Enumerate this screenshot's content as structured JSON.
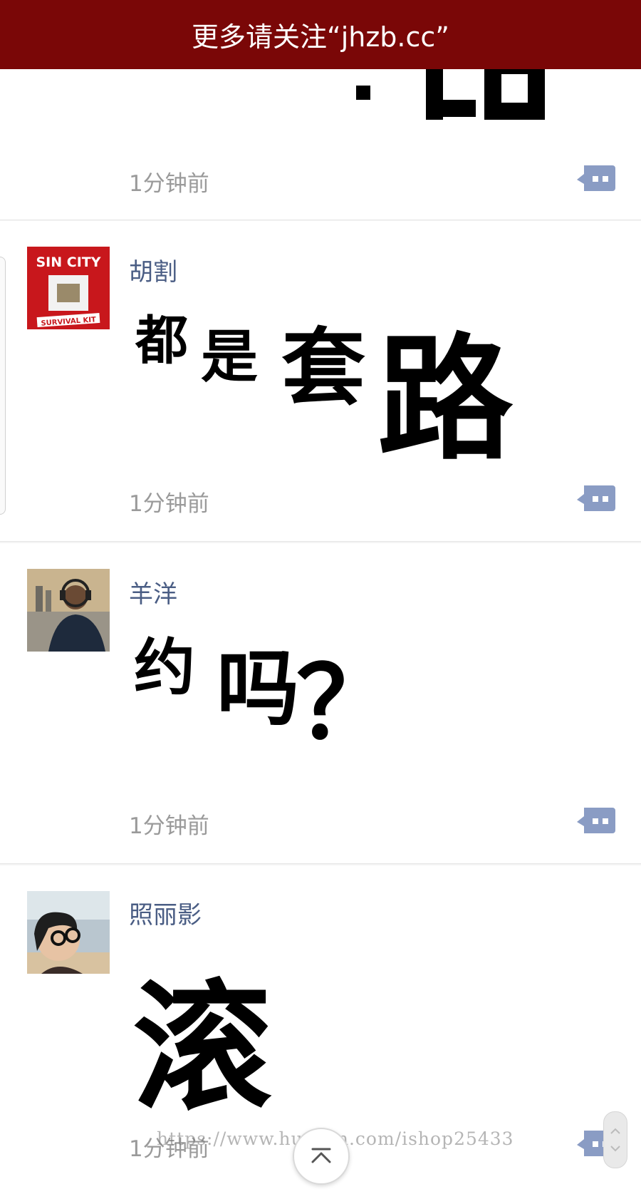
{
  "banner": {
    "text": "更多请关注“jhzb.cc”"
  },
  "cards": [
    {
      "time": "1分钟前"
    },
    {
      "username": "胡割",
      "sticker": [
        "都",
        "是",
        "套",
        "路"
      ],
      "time": "1分钟前",
      "avatar_text": [
        "SIN CITY",
        "SURVIVAL KIT"
      ]
    },
    {
      "username": "羊洋",
      "sticker": [
        "约",
        "吗",
        "？"
      ],
      "time": "1分钟前"
    },
    {
      "username": "照丽影",
      "sticker": [
        "滚"
      ],
      "time": "1分钟前"
    }
  ],
  "watermark": "https://www.huzhan.com/ishop25433",
  "icons": {
    "comment": "comment-bubble-icon",
    "back_to_top": "chevron-up-icon"
  },
  "colors": {
    "banner_bg": "#7a0707",
    "username": "#4a5d84",
    "icon": "#8a9cc4"
  }
}
